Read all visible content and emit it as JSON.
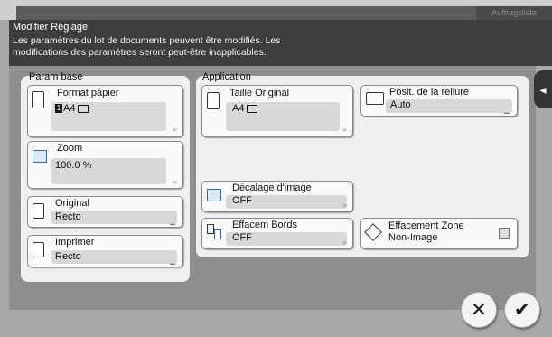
{
  "topbar": {
    "tab_label": "Auftragsliste"
  },
  "header": {
    "title": "Modifier Réglage",
    "message_line1": "Les paramètres du lot de documents peuvent être modifiés. Les",
    "message_line2": "modifications des paramètres seront peut-être inapplicables."
  },
  "param_base": {
    "title": "Param base",
    "format_papier": {
      "label": "Format papier",
      "badge": "1",
      "value": "A4"
    },
    "zoom": {
      "label": "Zoom",
      "value": "100.0  %"
    },
    "original": {
      "label": "Original",
      "value": "Recto"
    },
    "imprimer": {
      "label": "Imprimer",
      "value": "Recto"
    }
  },
  "application": {
    "title": "Application",
    "taille_original": {
      "label": "Taille Original",
      "value": "A4"
    },
    "posit_reliure": {
      "label": "Posit. de la reliure",
      "value": "Auto"
    },
    "decalage_image": {
      "label": "Décalage d'image",
      "value": "OFF"
    },
    "effacem_bords": {
      "label": "Effacem Bords",
      "value": "OFF"
    },
    "effacement_zone": {
      "label_line1": "Effacement Zone",
      "label_line2": "Non-Image"
    }
  },
  "actions": {
    "cancel_glyph": "✕",
    "ok_glyph": "✔"
  }
}
